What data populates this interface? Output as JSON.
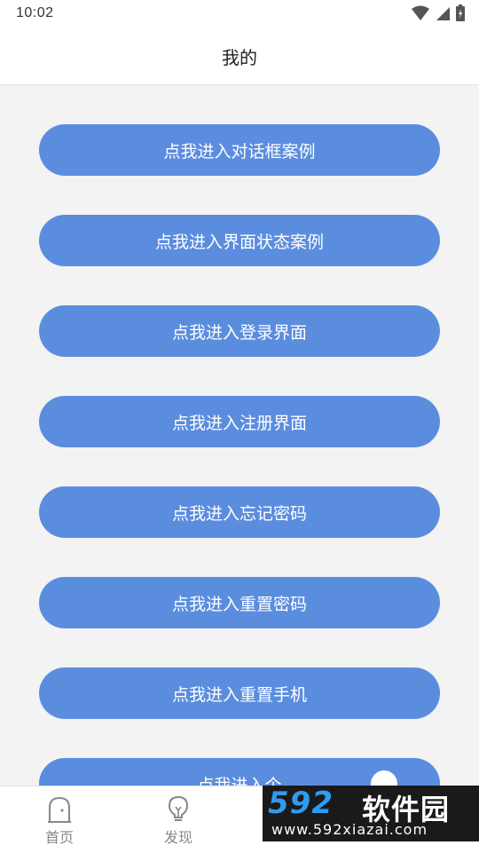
{
  "status": {
    "time": "10:02"
  },
  "header": {
    "title": "我的"
  },
  "buttons": [
    {
      "label": "点我进入对话框案例"
    },
    {
      "label": "点我进入界面状态案例"
    },
    {
      "label": "点我进入登录界面"
    },
    {
      "label": "点我进入注册界面"
    },
    {
      "label": "点我进入忘记密码"
    },
    {
      "label": "点我进入重置密码"
    },
    {
      "label": "点我进入重置手机"
    },
    {
      "label": "点我进入个"
    }
  ],
  "tabs": [
    {
      "label": "首页",
      "icon": "home-icon"
    },
    {
      "label": "发现",
      "icon": "lightbulb-icon"
    }
  ],
  "watermark": {
    "number": "592",
    "name": "软件园",
    "url": "www.592xiazai.com"
  },
  "colors": {
    "accent": "#5b8ddf",
    "background": "#f3f3f3",
    "tab_text": "#888888"
  }
}
